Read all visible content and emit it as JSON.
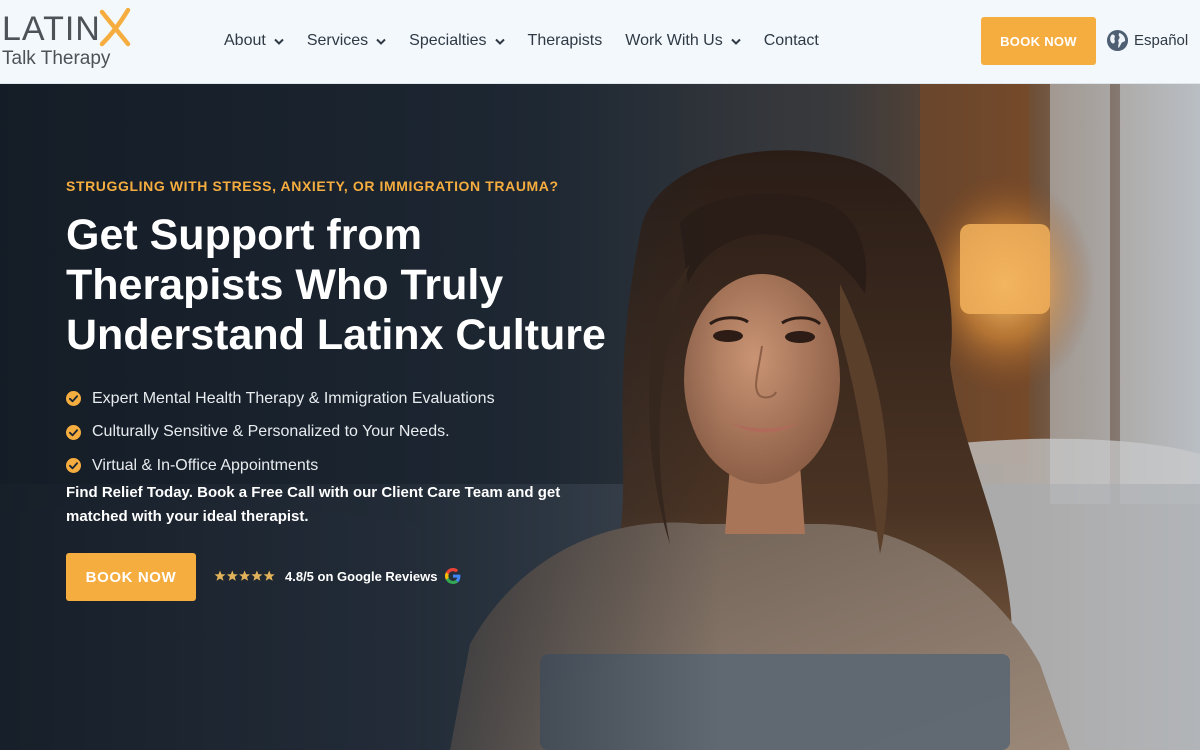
{
  "header": {
    "logo": {
      "word": "LATIN",
      "subtitle": "Talk Therapy",
      "accent": "#f6ad3f"
    },
    "nav": [
      {
        "label": "About",
        "has_dropdown": true
      },
      {
        "label": "Services",
        "has_dropdown": true
      },
      {
        "label": "Specialties",
        "has_dropdown": true
      },
      {
        "label": "Therapists",
        "has_dropdown": false
      },
      {
        "label": "Work With Us",
        "has_dropdown": true
      },
      {
        "label": "Contact",
        "has_dropdown": false
      }
    ],
    "book_button": "BOOK NOW",
    "language": {
      "icon": "globe-icon",
      "label": "Español"
    }
  },
  "hero": {
    "eyebrow": "STRUGGLING WITH STRESS, ANXIETY, OR IMMIGRATION TRAUMA?",
    "headline": [
      "Get Support from",
      "Therapists Who Truly",
      "Understand Latinx Culture"
    ],
    "bullets": [
      "Expert Mental Health Therapy & Immigration Evaluations",
      "Culturally Sensitive & Personalized to Your Needs.",
      "Virtual & In-Office Appointments"
    ],
    "relief_text": "Find Relief Today. Book a Free Call with our Client Care Team and get matched with your ideal therapist.",
    "book_button": "BOOK NOW",
    "reviews": {
      "stars": 5,
      "text": "4.8/5 on Google Reviews",
      "icon": "google-icon"
    }
  },
  "colors": {
    "accent": "#f6ad3f",
    "header_bg": "#f3f8fc",
    "hero_dark": "#1d2733",
    "nav_text": "#2f3a45"
  }
}
